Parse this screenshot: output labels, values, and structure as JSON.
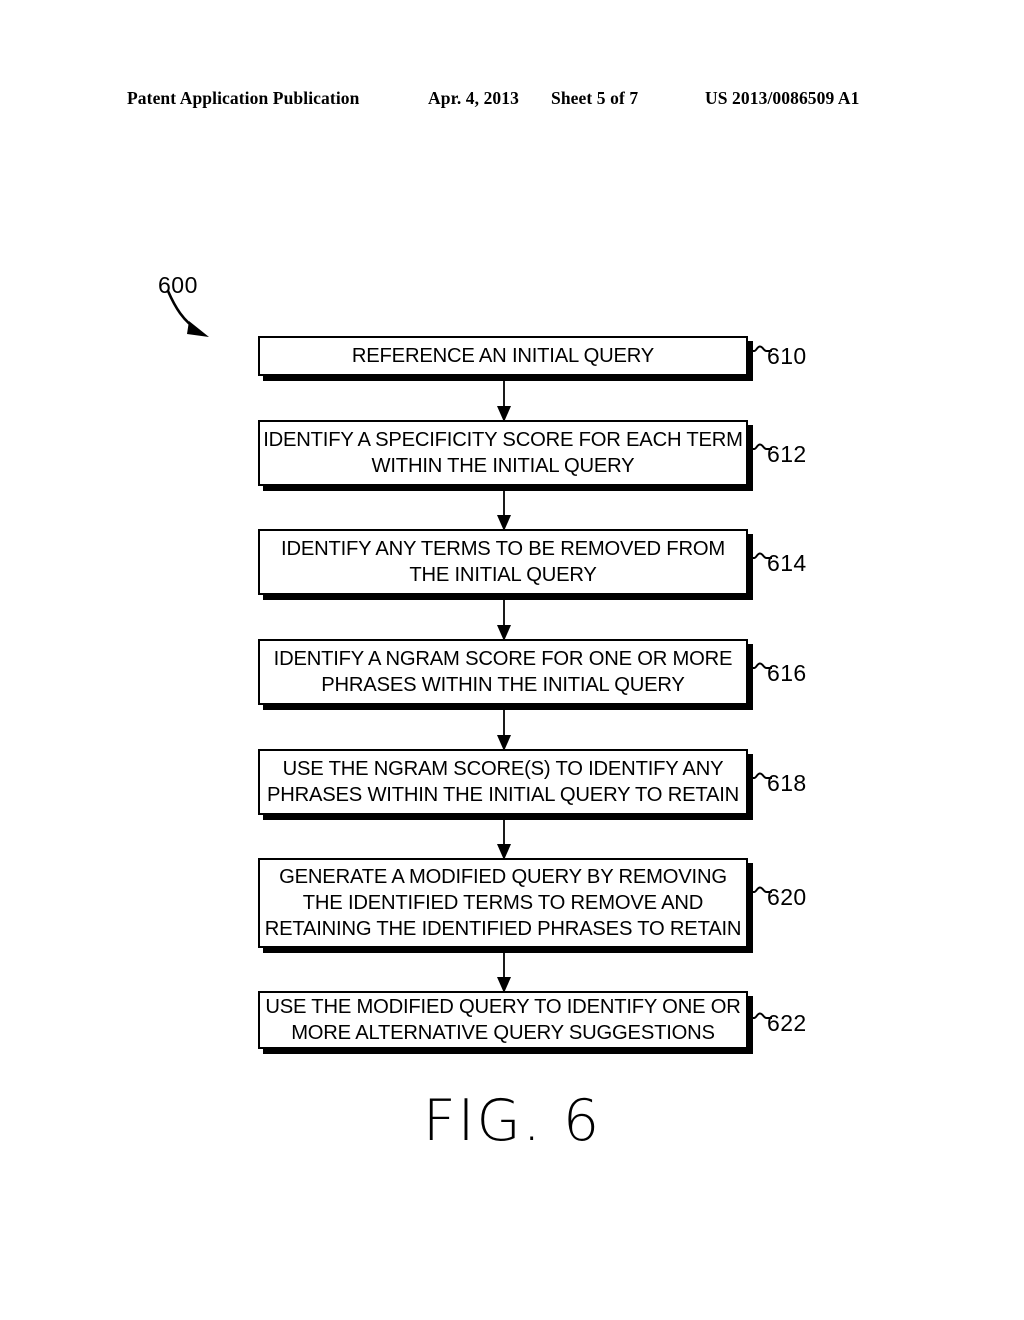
{
  "header": {
    "publication": "Patent Application Publication",
    "date": "Apr. 4, 2013",
    "sheet": "Sheet 5 of 7",
    "patent_number": "US 2013/0086509 A1"
  },
  "figure": {
    "caption": "FIG. 6",
    "diagram_reference": "600"
  },
  "flowchart": {
    "steps": [
      {
        "ref": "610",
        "ref_label": "~610",
        "text": "REFERENCE AN INITIAL QUERY"
      },
      {
        "ref": "612",
        "ref_label": "~612",
        "text": "IDENTIFY A SPECIFICITY SCORE FOR EACH TERM\nWITHIN THE INITIAL QUERY"
      },
      {
        "ref": "614",
        "ref_label": "~614",
        "text": "IDENTIFY ANY TERMS TO BE REMOVED FROM\nTHE INITIAL QUERY"
      },
      {
        "ref": "616",
        "ref_label": "~616",
        "text": "IDENTIFY A NGRAM SCORE FOR ONE OR MORE\nPHRASES WITHIN THE INITIAL QUERY"
      },
      {
        "ref": "618",
        "ref_label": "~618",
        "text": "USE THE NGRAM SCORE(S) TO IDENTIFY ANY\nPHRASES WITHIN THE INITIAL QUERY TO RETAIN"
      },
      {
        "ref": "620",
        "ref_label": "~620",
        "text": "GENERATE A MODIFIED QUERY BY REMOVING\nTHE IDENTIFIED TERMS TO REMOVE AND\nRETAINING THE IDENTIFIED PHRASES TO RETAIN"
      },
      {
        "ref": "622",
        "ref_label": "~622",
        "text": "USE THE MODIFIED QUERY TO IDENTIFY ONE OR\nMORE ALTERNATIVE QUERY SUGGESTIONS"
      }
    ]
  },
  "colors": {
    "ink": "#000000",
    "paper": "#ffffff"
  }
}
